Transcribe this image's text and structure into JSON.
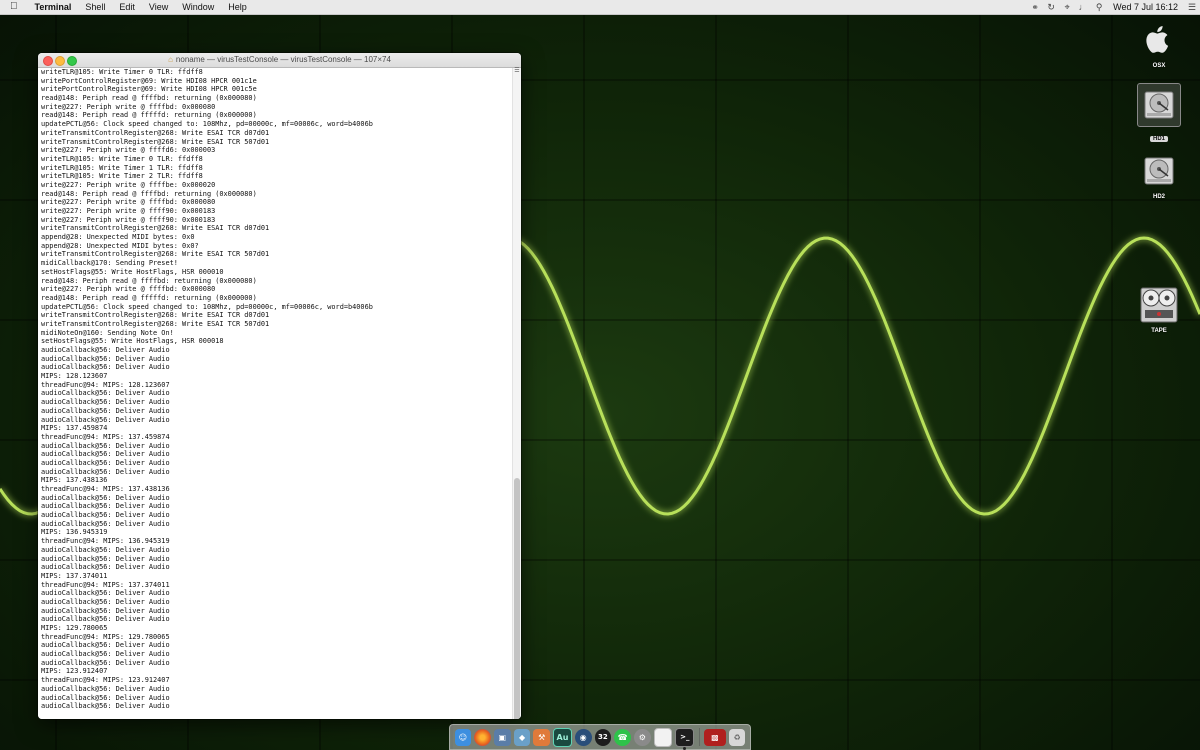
{
  "menubar": {
    "apple_icon": "apple-icon",
    "app_name": "Terminal",
    "menus": [
      "Shell",
      "Edit",
      "View",
      "Window",
      "Help"
    ],
    "status_icons": [
      "creative-cloud-icon",
      "time-machine-icon",
      "wifi-icon",
      "volume-icon",
      "search-icon"
    ],
    "clock": "Wed 7 Jul  16:12",
    "list_icon": "notification-list-icon"
  },
  "window": {
    "title": "noname — virusTestConsole — virusTestConsole — 107×74",
    "lines": [
      "writeTLR@105: Write Timer 0 TLR: ffdff8",
      "writePortControlRegister@69: Write HDI08 HPCR 001c1e",
      "writePortControlRegister@69: Write HDI08 HPCR 001c5e",
      "read@148: Periph read @ ffffbd: returning (0x000080)",
      "write@227: Periph write @ ffffbd: 0x000080",
      "read@148: Periph read @ fffffd: returning (0x000000)",
      "updatePCTL@56: Clock speed changed to: 108Mhz, pd=00000c, mf=00006c, word=b4006b",
      "writeTransmitControlRegister@268: Write ESAI TCR d07d01",
      "writeTransmitControlRegister@268: Write ESAI TCR 507d01",
      "write@227: Periph write @ ffffd6: 0x000003",
      "writeTLR@105: Write Timer 0 TLR: ffdff8",
      "writeTLR@105: Write Timer 1 TLR: ffdff8",
      "writeTLR@105: Write Timer 2 TLR: ffdff8",
      "write@227: Periph write @ ffffbe: 0x000020",
      "read@148: Periph read @ ffffbd: returning (0x000080)",
      "write@227: Periph write @ ffffbd: 0x000080",
      "write@227: Periph write @ ffff90: 0x000183",
      "write@227: Periph write @ ffff90: 0x000183",
      "writeTransmitControlRegister@268: Write ESAI TCR d07d01",
      "append@28: Unexpected MIDI bytes: 0x0",
      "append@28: Unexpected MIDI bytes: 0x0?",
      "writeTransmitControlRegister@268: Write ESAI TCR 507d01",
      "midiCallback@170: Sending Preset!",
      "setHostFlags@55: Write HostFlags, HSR 000010",
      "read@148: Periph read @ ffffbd: returning (0x000080)",
      "write@227: Periph write @ ffffbd: 0x000080",
      "read@148: Periph read @ fffffd: returning (0x000000)",
      "updatePCTL@56: Clock speed changed to: 108Mhz, pd=00000c, mf=00006c, word=b4006b",
      "writeTransmitControlRegister@268: Write ESAI TCR d07d01",
      "writeTransmitControlRegister@268: Write ESAI TCR 507d01",
      "midiNoteOn@160: Sending Note On!",
      "setHostFlags@55: Write HostFlags, HSR 000018",
      "audioCallback@56: Deliver Audio",
      "audioCallback@56: Deliver Audio",
      "audioCallback@56: Deliver Audio",
      "MIPS: 128.123607",
      "threadFunc@94: MIPS: 128.123607",
      "audioCallback@56: Deliver Audio",
      "audioCallback@56: Deliver Audio",
      "audioCallback@56: Deliver Audio",
      "audioCallback@56: Deliver Audio",
      "MIPS: 137.459874",
      "threadFunc@94: MIPS: 137.459874",
      "audioCallback@56: Deliver Audio",
      "audioCallback@56: Deliver Audio",
      "audioCallback@56: Deliver Audio",
      "audioCallback@56: Deliver Audio",
      "MIPS: 137.438136",
      "threadFunc@94: MIPS: 137.438136",
      "audioCallback@56: Deliver Audio",
      "audioCallback@56: Deliver Audio",
      "audioCallback@56: Deliver Audio",
      "audioCallback@56: Deliver Audio",
      "MIPS: 136.945319",
      "threadFunc@94: MIPS: 136.945319",
      "audioCallback@56: Deliver Audio",
      "audioCallback@56: Deliver Audio",
      "audioCallback@56: Deliver Audio",
      "MIPS: 137.374011",
      "threadFunc@94: MIPS: 137.374011",
      "audioCallback@56: Deliver Audio",
      "audioCallback@56: Deliver Audio",
      "audioCallback@56: Deliver Audio",
      "audioCallback@56: Deliver Audio",
      "MIPS: 129.780065",
      "threadFunc@94: MIPS: 129.780065",
      "audioCallback@56: Deliver Audio",
      "audioCallback@56: Deliver Audio",
      "audioCallback@56: Deliver Audio",
      "MIPS: 123.912407",
      "threadFunc@94: MIPS: 123.912407",
      "audioCallback@56: Deliver Audio",
      "audioCallback@56: Deliver Audio",
      "audioCallback@56: Deliver Audio"
    ]
  },
  "desktop_icons": [
    {
      "label": "OSX",
      "icon": "apple-logo-icon"
    },
    {
      "label": "HD1",
      "icon": "hard-disk-icon",
      "selected": true
    },
    {
      "label": "HD2",
      "icon": "hard-disk-icon"
    },
    {
      "label": "TAPE",
      "icon": "tape-reel-icon"
    }
  ],
  "dock": [
    {
      "name": "finder",
      "icon": "finder-icon",
      "color": "#3d8fe0"
    },
    {
      "name": "firefox",
      "icon": "firefox-icon",
      "color": "#e6601d"
    },
    {
      "name": "preview",
      "icon": "preview-icon",
      "color": "#5a7da8"
    },
    {
      "name": "unknown-app",
      "icon": "kite-icon",
      "color": "#6aa0c8"
    },
    {
      "name": "unknown-app-2",
      "icon": "wrench-icon",
      "color": "#e07a3a"
    },
    {
      "name": "audition",
      "icon": "audition-icon",
      "color": "#1a4a40",
      "text": "Au"
    },
    {
      "name": "dj-app",
      "icon": "dj-disc-icon",
      "color": "#2a4e7a"
    },
    {
      "name": "app-32",
      "icon": "32-icon",
      "color": "#1d1d1d",
      "text": "32"
    },
    {
      "name": "whatsapp",
      "icon": "whatsapp-icon",
      "color": "#2ec24a"
    },
    {
      "name": "system-preferences",
      "icon": "gear-icon",
      "color": "#8a8a8a"
    },
    {
      "name": "document",
      "icon": "document-icon",
      "color": "#f2f2f2"
    },
    {
      "name": "terminal",
      "icon": "terminal-icon",
      "color": "#1e1e1e",
      "running": true
    },
    {
      "name": "virus-app",
      "icon": "synth-icon",
      "color": "#b0201e"
    },
    {
      "name": "trash",
      "icon": "trash-icon",
      "color": "#d8d8d8"
    }
  ]
}
